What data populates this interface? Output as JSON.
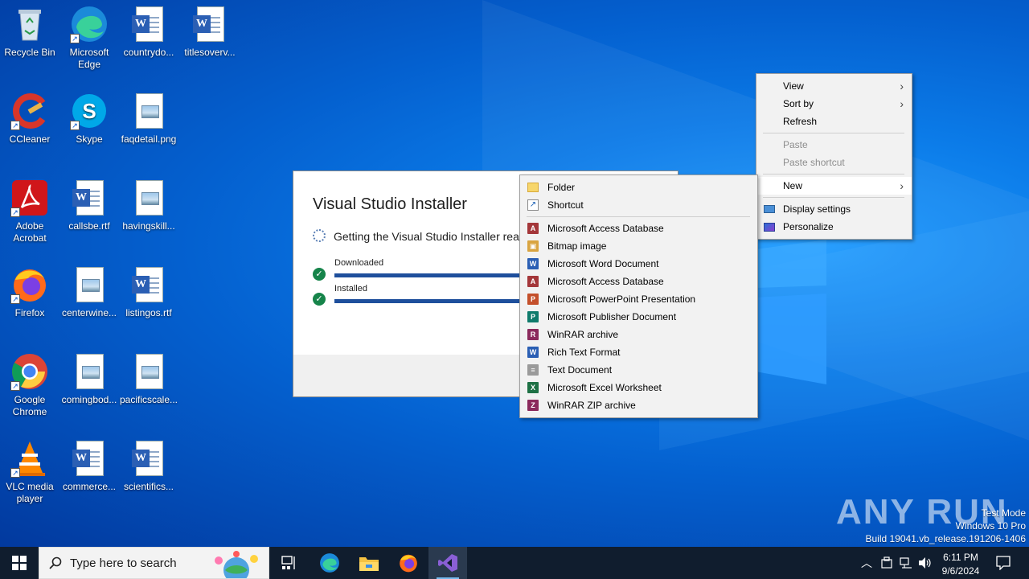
{
  "desktop": {
    "icons": [
      {
        "label": "Recycle Bin",
        "icon": "recycle-bin-icon"
      },
      {
        "label": "Microsoft Edge",
        "icon": "edge-icon"
      },
      {
        "label": "countrydo...",
        "icon": "word-doc-icon"
      },
      {
        "label": "titlesoverv...",
        "icon": "word-doc-icon"
      },
      {
        "label": "CCleaner",
        "icon": "ccleaner-icon"
      },
      {
        "label": "Skype",
        "icon": "skype-icon"
      },
      {
        "label": "faqdetail.png",
        "icon": "image-file-icon"
      },
      {
        "label": "Adobe Acrobat",
        "icon": "acrobat-icon"
      },
      {
        "label": "callsbe.rtf",
        "icon": "word-doc-icon"
      },
      {
        "label": "havingskill...",
        "icon": "image-file-icon"
      },
      {
        "label": "Firefox",
        "icon": "firefox-icon"
      },
      {
        "label": "centerwine...",
        "icon": "image-file-icon"
      },
      {
        "label": "listingos.rtf",
        "icon": "word-doc-icon"
      },
      {
        "label": "Google Chrome",
        "icon": "chrome-icon"
      },
      {
        "label": "comingbod...",
        "icon": "image-file-icon"
      },
      {
        "label": "pacificscale...",
        "icon": "image-file-icon"
      },
      {
        "label": "VLC media player",
        "icon": "vlc-icon"
      },
      {
        "label": "commerce...",
        "icon": "word-doc-icon"
      },
      {
        "label": "scientifics...",
        "icon": "word-doc-icon"
      }
    ]
  },
  "installer": {
    "title": "Visual Studio Installer",
    "status": "Getting the Visual Studio Installer ready.",
    "downloaded_label": "Downloaded",
    "installed_label": "Installed",
    "downloaded_progress": 1.0,
    "installed_progress": 1.0
  },
  "context_menu": {
    "view": "View",
    "sort_by": "Sort by",
    "refresh": "Refresh",
    "paste": "Paste",
    "paste_shortcut": "Paste shortcut",
    "new": "New",
    "display_settings": "Display settings",
    "personalize": "Personalize"
  },
  "new_submenu": {
    "folder": "Folder",
    "shortcut": "Shortcut",
    "items": [
      {
        "label": "Microsoft Access Database",
        "icon": "access-icon",
        "color": "#a4373a",
        "glyph": "A"
      },
      {
        "label": "Bitmap image",
        "icon": "bitmap-icon",
        "color": "#d9a441",
        "glyph": "▣"
      },
      {
        "label": "Microsoft Word Document",
        "icon": "word-icon",
        "color": "#2b5fb4",
        "glyph": "W"
      },
      {
        "label": "Microsoft Access Database",
        "icon": "access-icon",
        "color": "#a4373a",
        "glyph": "A"
      },
      {
        "label": "Microsoft PowerPoint Presentation",
        "icon": "powerpoint-icon",
        "color": "#c4502b",
        "glyph": "P"
      },
      {
        "label": "Microsoft Publisher Document",
        "icon": "publisher-icon",
        "color": "#0f7b6c",
        "glyph": "P"
      },
      {
        "label": "WinRAR archive",
        "icon": "winrar-icon",
        "color": "#8b2a5c",
        "glyph": "R"
      },
      {
        "label": "Rich Text Format",
        "icon": "rtf-icon",
        "color": "#2b5fb4",
        "glyph": "W"
      },
      {
        "label": "Text Document",
        "icon": "text-doc-icon",
        "color": "#9a9a9a",
        "glyph": "≡"
      },
      {
        "label": "Microsoft Excel Worksheet",
        "icon": "excel-icon",
        "color": "#1e7145",
        "glyph": "X"
      },
      {
        "label": "WinRAR ZIP archive",
        "icon": "winrar-zip-icon",
        "color": "#8b2a5c",
        "glyph": "Z"
      }
    ]
  },
  "watermark": {
    "logo": "ANY RUN",
    "line1": "Test Mode",
    "line2": "Windows 10 Pro",
    "line3": "Build 19041.vb_release.191206-1406"
  },
  "taskbar": {
    "search_placeholder": "Type here to search",
    "time": "6:11 PM",
    "date": "9/6/2024"
  }
}
